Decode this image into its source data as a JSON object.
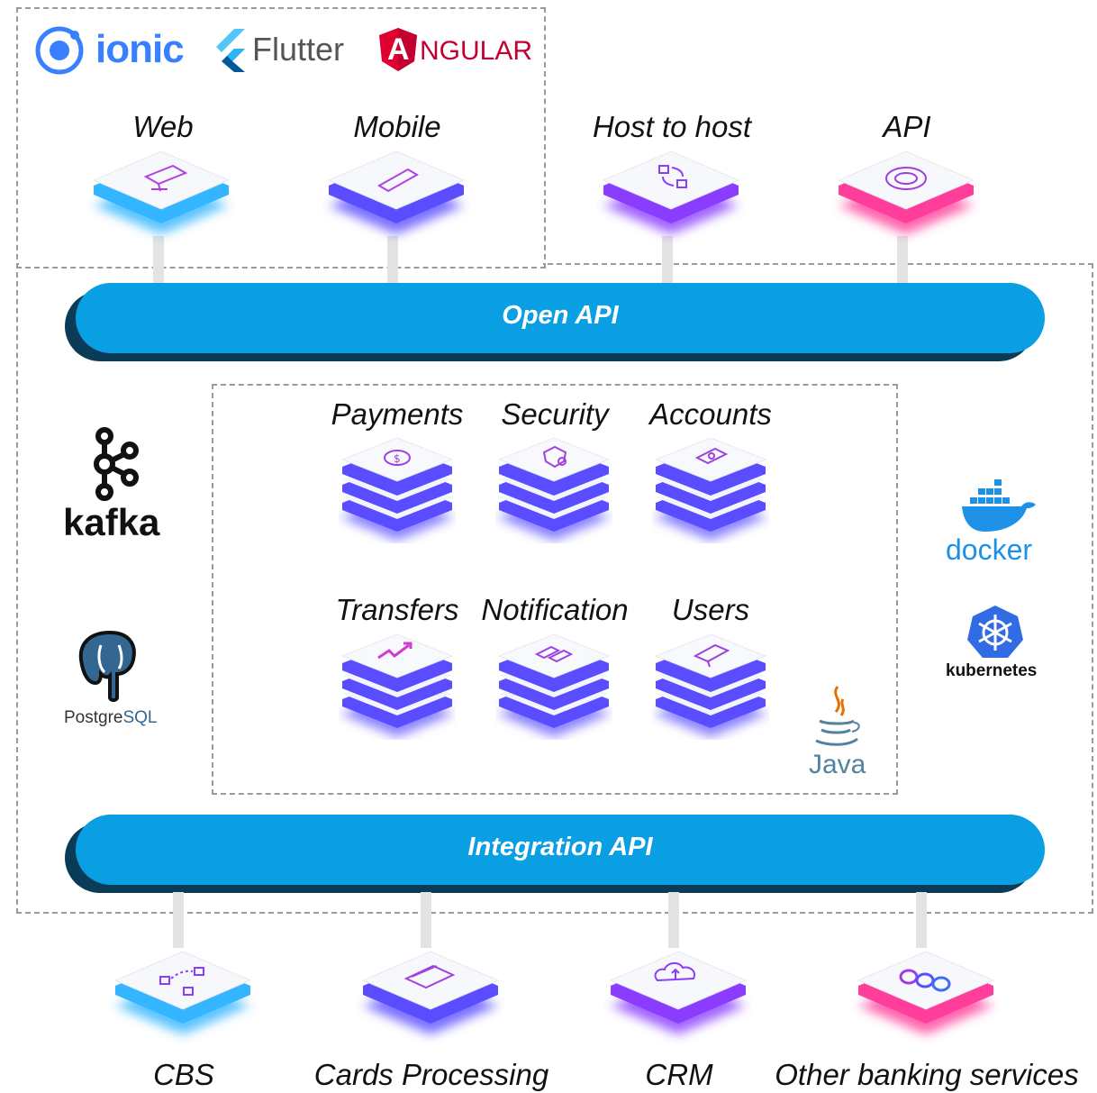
{
  "frontend_logos": {
    "ionic": "ionic",
    "flutter": "Flutter",
    "angular_a": "A",
    "angular_rest": "NGULAR"
  },
  "channels": [
    {
      "label": "Web",
      "icon": "web-monitor-icon",
      "glow": "#33b5ff"
    },
    {
      "label": "Mobile",
      "icon": "mobile-phone-icon",
      "glow": "#5a4dff"
    },
    {
      "label": "Host to host",
      "icon": "host-to-host-icon",
      "glow": "#8a3dff"
    },
    {
      "label": "API",
      "icon": "api-gear-icon",
      "glow": "#ff3d9a"
    }
  ],
  "open_api": {
    "label": "Open API"
  },
  "integration_api": {
    "label": "Integration API"
  },
  "services_row1": [
    {
      "label": "Payments",
      "icon": "payments-icon"
    },
    {
      "label": "Security",
      "icon": "security-icon"
    },
    {
      "label": "Accounts",
      "icon": "accounts-icon"
    }
  ],
  "services_row2": [
    {
      "label": "Transfers",
      "icon": "transfers-icon"
    },
    {
      "label": "Notification",
      "icon": "notification-icon"
    },
    {
      "label": "Users",
      "icon": "users-icon"
    }
  ],
  "infra_logos": {
    "kafka": "kafka",
    "postgres_a": "Postgre",
    "postgres_b": "SQL",
    "docker": "docker",
    "kubernetes": "kubernetes",
    "java": "Java"
  },
  "backends": [
    {
      "label": "CBS",
      "icon": "cbs-network-icon",
      "glow": "#33b5ff"
    },
    {
      "label": "Cards Processing",
      "icon": "cards-processing-icon",
      "glow": "#5a4dff"
    },
    {
      "label": "CRM",
      "icon": "crm-cloud-icon",
      "glow": "#8a3dff"
    },
    {
      "label": "Other banking services",
      "icon": "other-services-icon",
      "glow": "#ff3d9a"
    }
  ],
  "colors": {
    "api_bar": "#0a9ee3",
    "api_bar_shadow": "#0b3c57",
    "stack_glow": "#5a4dff"
  }
}
